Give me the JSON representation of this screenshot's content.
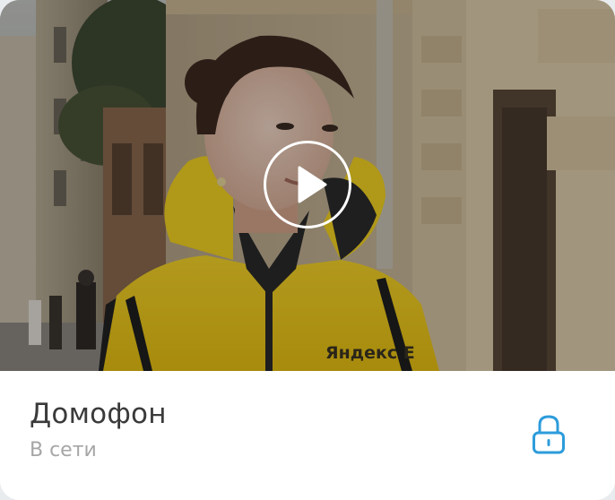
{
  "card": {
    "title": "Домофон",
    "status": "В сети"
  },
  "video": {
    "preview": "camera-feed-image",
    "jacket_print": "Яндекс Е"
  },
  "icons": {
    "play": "play-icon",
    "lock": "lock-icon"
  },
  "colors": {
    "accent": "#2d9cdb",
    "title": "#3a3a3a",
    "status": "#a6a6a6",
    "jacket": "#f2cf1e"
  }
}
